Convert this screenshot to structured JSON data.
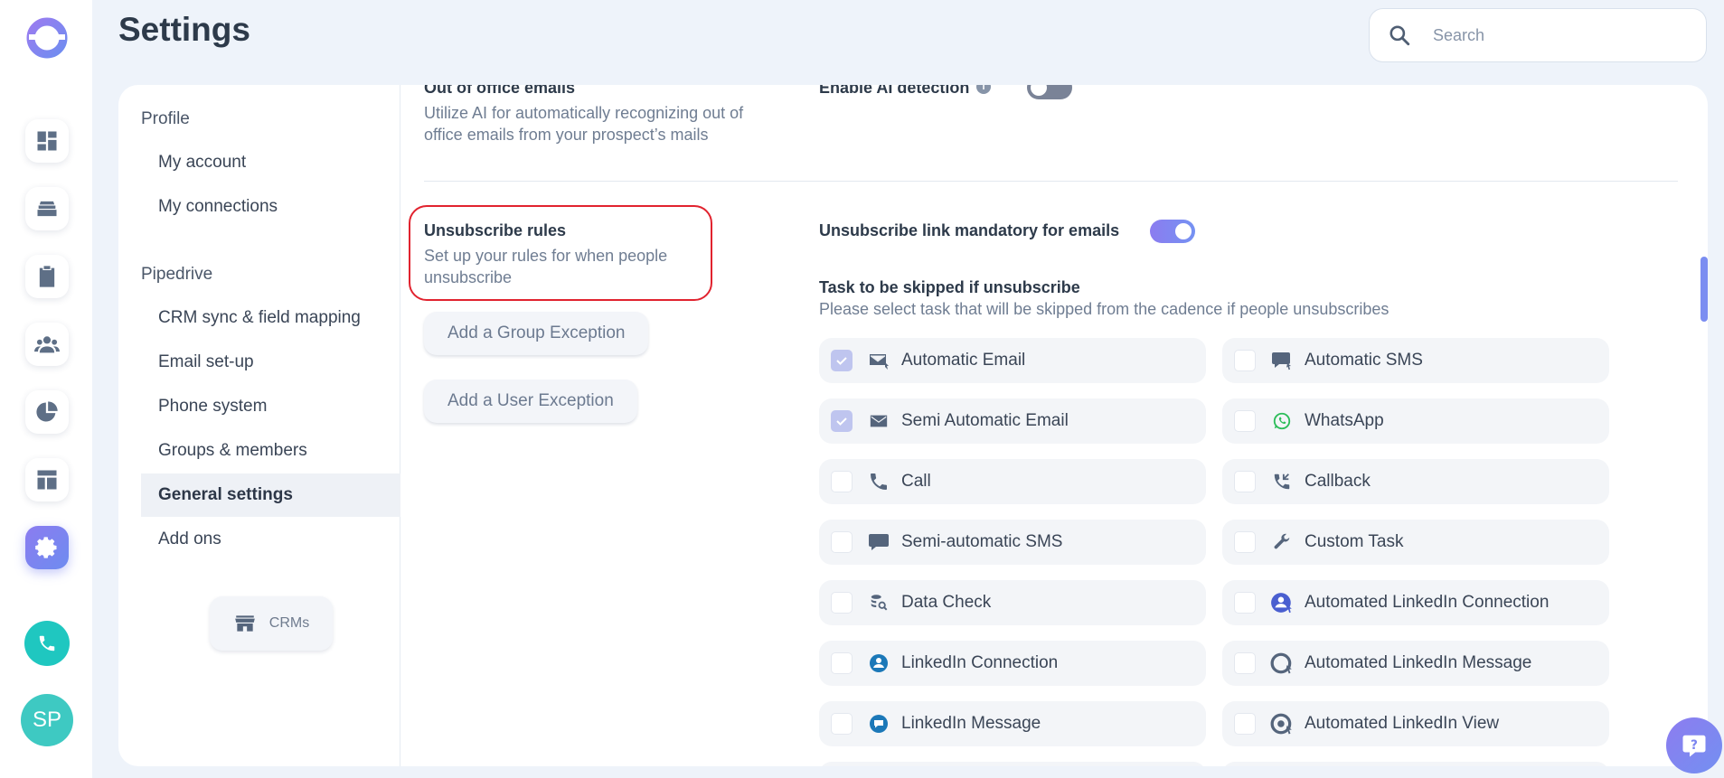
{
  "app": {
    "title": "Settings",
    "avatar_initials": "SP",
    "accent_color": "#7b84f0",
    "rail": [
      "dashboard-icon",
      "inbox-stack-icon",
      "clipboard-icon",
      "people-icon",
      "pie-chart-icon",
      "layout-icon",
      "gear-icon"
    ]
  },
  "search": {
    "placeholder": "Search"
  },
  "nav": {
    "group_profile": "Profile",
    "my_account": "My account",
    "my_connections": "My connections",
    "group_pipedrive": "Pipedrive",
    "crm_sync": "CRM sync & field mapping",
    "email_setup": "Email set-up",
    "phone_system": "Phone system",
    "groups_members": "Groups & members",
    "general_settings": "General settings",
    "add_ons": "Add ons",
    "crms_button": "CRMs"
  },
  "ooo": {
    "title": "Out of office emails",
    "desc": "Utilize AI for automatically recognizing out of office emails from your prospect’s mails",
    "ai_label": "Enable AI detection",
    "ai_enabled": false
  },
  "unsub": {
    "title": "Unsubscribe rules",
    "desc": "Set up your rules for when people unsubscribe",
    "group_exception": "Add a Group Exception",
    "user_exception": "Add a User Exception",
    "link_mandatory_label": "Unsubscribe link mandatory for emails",
    "link_mandatory": true,
    "skip_title": "Task to be skipped if unsubscribe",
    "skip_desc": "Please select task that will be skipped from the cadence if people unsubscribes"
  },
  "tasks": [
    {
      "label": "Automatic Email",
      "checked": true,
      "icon": "auto-email-icon"
    },
    {
      "label": "Automatic SMS",
      "checked": false,
      "icon": "auto-sms-icon"
    },
    {
      "label": "Semi Automatic Email",
      "checked": true,
      "icon": "email-icon"
    },
    {
      "label": "WhatsApp",
      "checked": false,
      "icon": "whatsapp-icon"
    },
    {
      "label": "Call",
      "checked": false,
      "icon": "phone-icon"
    },
    {
      "label": "Callback",
      "checked": false,
      "icon": "callback-icon"
    },
    {
      "label": "Semi-automatic SMS",
      "checked": false,
      "icon": "sms-icon"
    },
    {
      "label": "Custom Task",
      "checked": false,
      "icon": "wrench-icon"
    },
    {
      "label": "Data Check",
      "checked": false,
      "icon": "data-check-icon"
    },
    {
      "label": "Automated LinkedIn Connection",
      "checked": false,
      "icon": "auto-linkedin-connection-icon"
    },
    {
      "label": "LinkedIn Connection",
      "checked": false,
      "icon": "linkedin-connection-icon"
    },
    {
      "label": "Automated LinkedIn Message",
      "checked": false,
      "icon": "auto-linkedin-message-icon"
    },
    {
      "label": "LinkedIn Message",
      "checked": false,
      "icon": "linkedin-message-icon"
    },
    {
      "label": "Automated LinkedIn View",
      "checked": false,
      "icon": "auto-linkedin-view-icon"
    }
  ]
}
